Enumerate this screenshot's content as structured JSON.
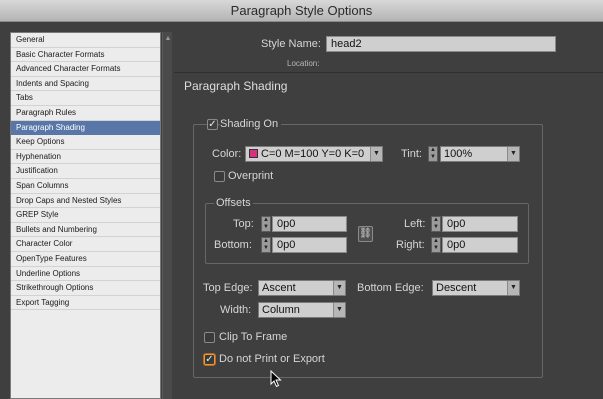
{
  "window": {
    "title": "Paragraph Style Options"
  },
  "sidebar": {
    "items": [
      {
        "label": "General",
        "selected": false
      },
      {
        "label": "Basic Character Formats",
        "selected": false
      },
      {
        "label": "Advanced Character Formats",
        "selected": false
      },
      {
        "label": "Indents and Spacing",
        "selected": false
      },
      {
        "label": "Tabs",
        "selected": false
      },
      {
        "label": "Paragraph Rules",
        "selected": false
      },
      {
        "label": "Paragraph Shading",
        "selected": true
      },
      {
        "label": "Keep Options",
        "selected": false
      },
      {
        "label": "Hyphenation",
        "selected": false
      },
      {
        "label": "Justification",
        "selected": false
      },
      {
        "label": "Span Columns",
        "selected": false
      },
      {
        "label": "Drop Caps and Nested Styles",
        "selected": false
      },
      {
        "label": "GREP Style",
        "selected": false
      },
      {
        "label": "Bullets and Numbering",
        "selected": false
      },
      {
        "label": "Character Color",
        "selected": false
      },
      {
        "label": "OpenType Features",
        "selected": false
      },
      {
        "label": "Underline Options",
        "selected": false
      },
      {
        "label": "Strikethrough Options",
        "selected": false
      },
      {
        "label": "Export Tagging",
        "selected": false
      }
    ]
  },
  "header": {
    "style_name_label": "Style Name:",
    "style_name_value": "head2",
    "location_label": "Location:"
  },
  "section": {
    "title": "Paragraph Shading"
  },
  "shading": {
    "shading_on_label": "Shading On",
    "shading_on_checked": true,
    "color_label": "Color:",
    "color_value": "C=0 M=100 Y=0 K=0",
    "color_swatch": "#d8317f",
    "tint_label": "Tint:",
    "tint_value": "100%",
    "overprint_label": "Overprint",
    "overprint_checked": false
  },
  "offsets": {
    "group_label": "Offsets",
    "top_label": "Top:",
    "top_value": "0p0",
    "bottom_label": "Bottom:",
    "bottom_value": "0p0",
    "left_label": "Left:",
    "left_value": "0p0",
    "right_label": "Right:",
    "right_value": "0p0"
  },
  "edges": {
    "top_edge_label": "Top Edge:",
    "top_edge_value": "Ascent",
    "bottom_edge_label": "Bottom Edge:",
    "bottom_edge_value": "Descent",
    "width_label": "Width:",
    "width_value": "Column"
  },
  "options": {
    "clip_to_frame_label": "Clip To Frame",
    "clip_to_frame_checked": false,
    "do_not_print_label": "Do not Print or Export",
    "do_not_print_checked": true
  },
  "glyphs": {
    "check": "✓",
    "dd_arrow": "▼",
    "step_up": "▲",
    "step_down": "▼",
    "chain": "⛓",
    "scroll_up": "▲"
  },
  "colors": {
    "selection": "#5877a8",
    "focus_ring": "#e8973a"
  }
}
